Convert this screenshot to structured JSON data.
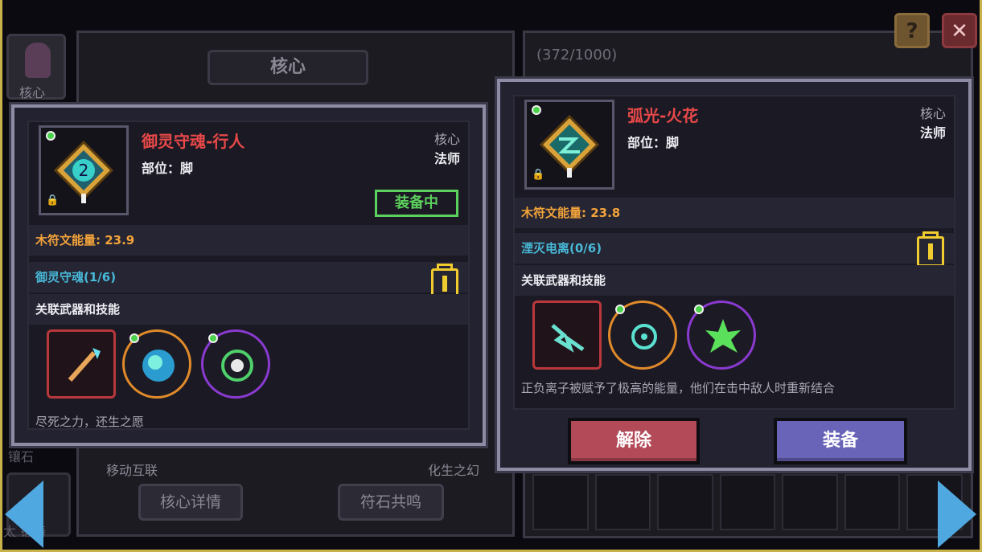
{
  "background": {
    "core_title": "核心",
    "progress": "(372/1000)",
    "sidebar_core_label": "核心",
    "sidebar_label_2": "镶石",
    "sidebar_label_3": "太  锻铸",
    "text_move": "移动互联",
    "text_transform": "化生之幻",
    "btn_core_details": "核心详情",
    "btn_rune_resonance": "符石共鸣"
  },
  "top_buttons": {
    "help": "?",
    "close": "✕"
  },
  "current_item": {
    "name": "御灵守魂-行人",
    "slot": "部位：脚",
    "type": "核心",
    "class": "法师",
    "equipped_badge": "装备中",
    "energy": "木符文能量: 23.9",
    "set_name": "御灵守魂(1/6)",
    "related_label": "关联武器和技能",
    "skills": [
      "staff-weapon-icon",
      "spirit-orb-skill-icon",
      "rune-circle-skill-icon"
    ],
    "flavor": "尽死之力，还生之愿"
  },
  "new_item": {
    "name": "弧光-火花",
    "slot": "部位：脚",
    "type": "核心",
    "class": "法师",
    "energy": "木符文能量: 23.8",
    "set_name": "湮灭电离(0/6)",
    "related_label": "关联武器和技能",
    "skills": [
      "lightning-gun-weapon-icon",
      "arc-orb-skill-icon",
      "green-spark-skill-icon"
    ],
    "flavor": "正负离子被赋予了极高的能量，他们在击中敌人时重新结合",
    "unequip_label": "解除",
    "equip_label": "装备"
  },
  "colors": {
    "item_name": "#e84848",
    "energy": "#f2a33a",
    "set_name": "#48b9d8",
    "equipped": "#5cd05c",
    "unequip_button": "#b24a58",
    "equip_button": "#6a64b8"
  }
}
